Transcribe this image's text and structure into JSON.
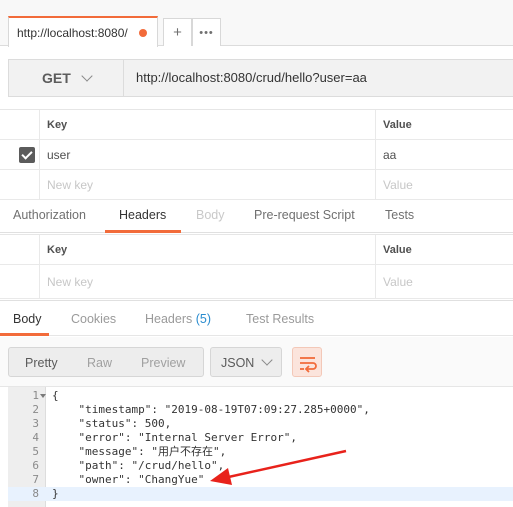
{
  "tab": {
    "title": "http://localhost:8080/",
    "add_label": "+",
    "more_label": "•••"
  },
  "request": {
    "method": "GET",
    "url": "http://localhost:8080/crud/hello?user=aa"
  },
  "params": {
    "key_header": "Key",
    "value_header": "Value",
    "rows": [
      {
        "key": "user",
        "value": "aa",
        "checked": true
      }
    ],
    "new_key_placeholder": "New key",
    "new_value_placeholder": "Value"
  },
  "request_tabs": [
    "Authorization",
    "Headers",
    "Body",
    "Pre-request Script",
    "Tests"
  ],
  "headers_table": {
    "key_header": "Key",
    "value_header": "Value",
    "new_key_placeholder": "New key",
    "new_value_placeholder": "Value"
  },
  "response_tabs": {
    "body": "Body",
    "cookies": "Cookies",
    "headers": "Headers",
    "headers_count": "(5)",
    "test_results": "Test Results"
  },
  "view_modes": {
    "pretty": "Pretty",
    "raw": "Raw",
    "preview": "Preview",
    "format": "JSON"
  },
  "code": {
    "line_numbers": [
      "1",
      "2",
      "3",
      "4",
      "5",
      "6",
      "7",
      "8"
    ],
    "lines": [
      "{",
      "    \"timestamp\": \"2019-08-19T07:09:27.285+0000\",",
      "    \"status\": 500,",
      "    \"error\": \"Internal Server Error\",",
      "    \"message\": \"用户不存在\",",
      "    \"path\": \"/crud/hello\",",
      "    \"owner\": \"ChangYue\"",
      "}"
    ]
  },
  "colors": {
    "accent": "#f26b3a",
    "annotation": "#e8221b",
    "link": "#2a8ccf"
  }
}
